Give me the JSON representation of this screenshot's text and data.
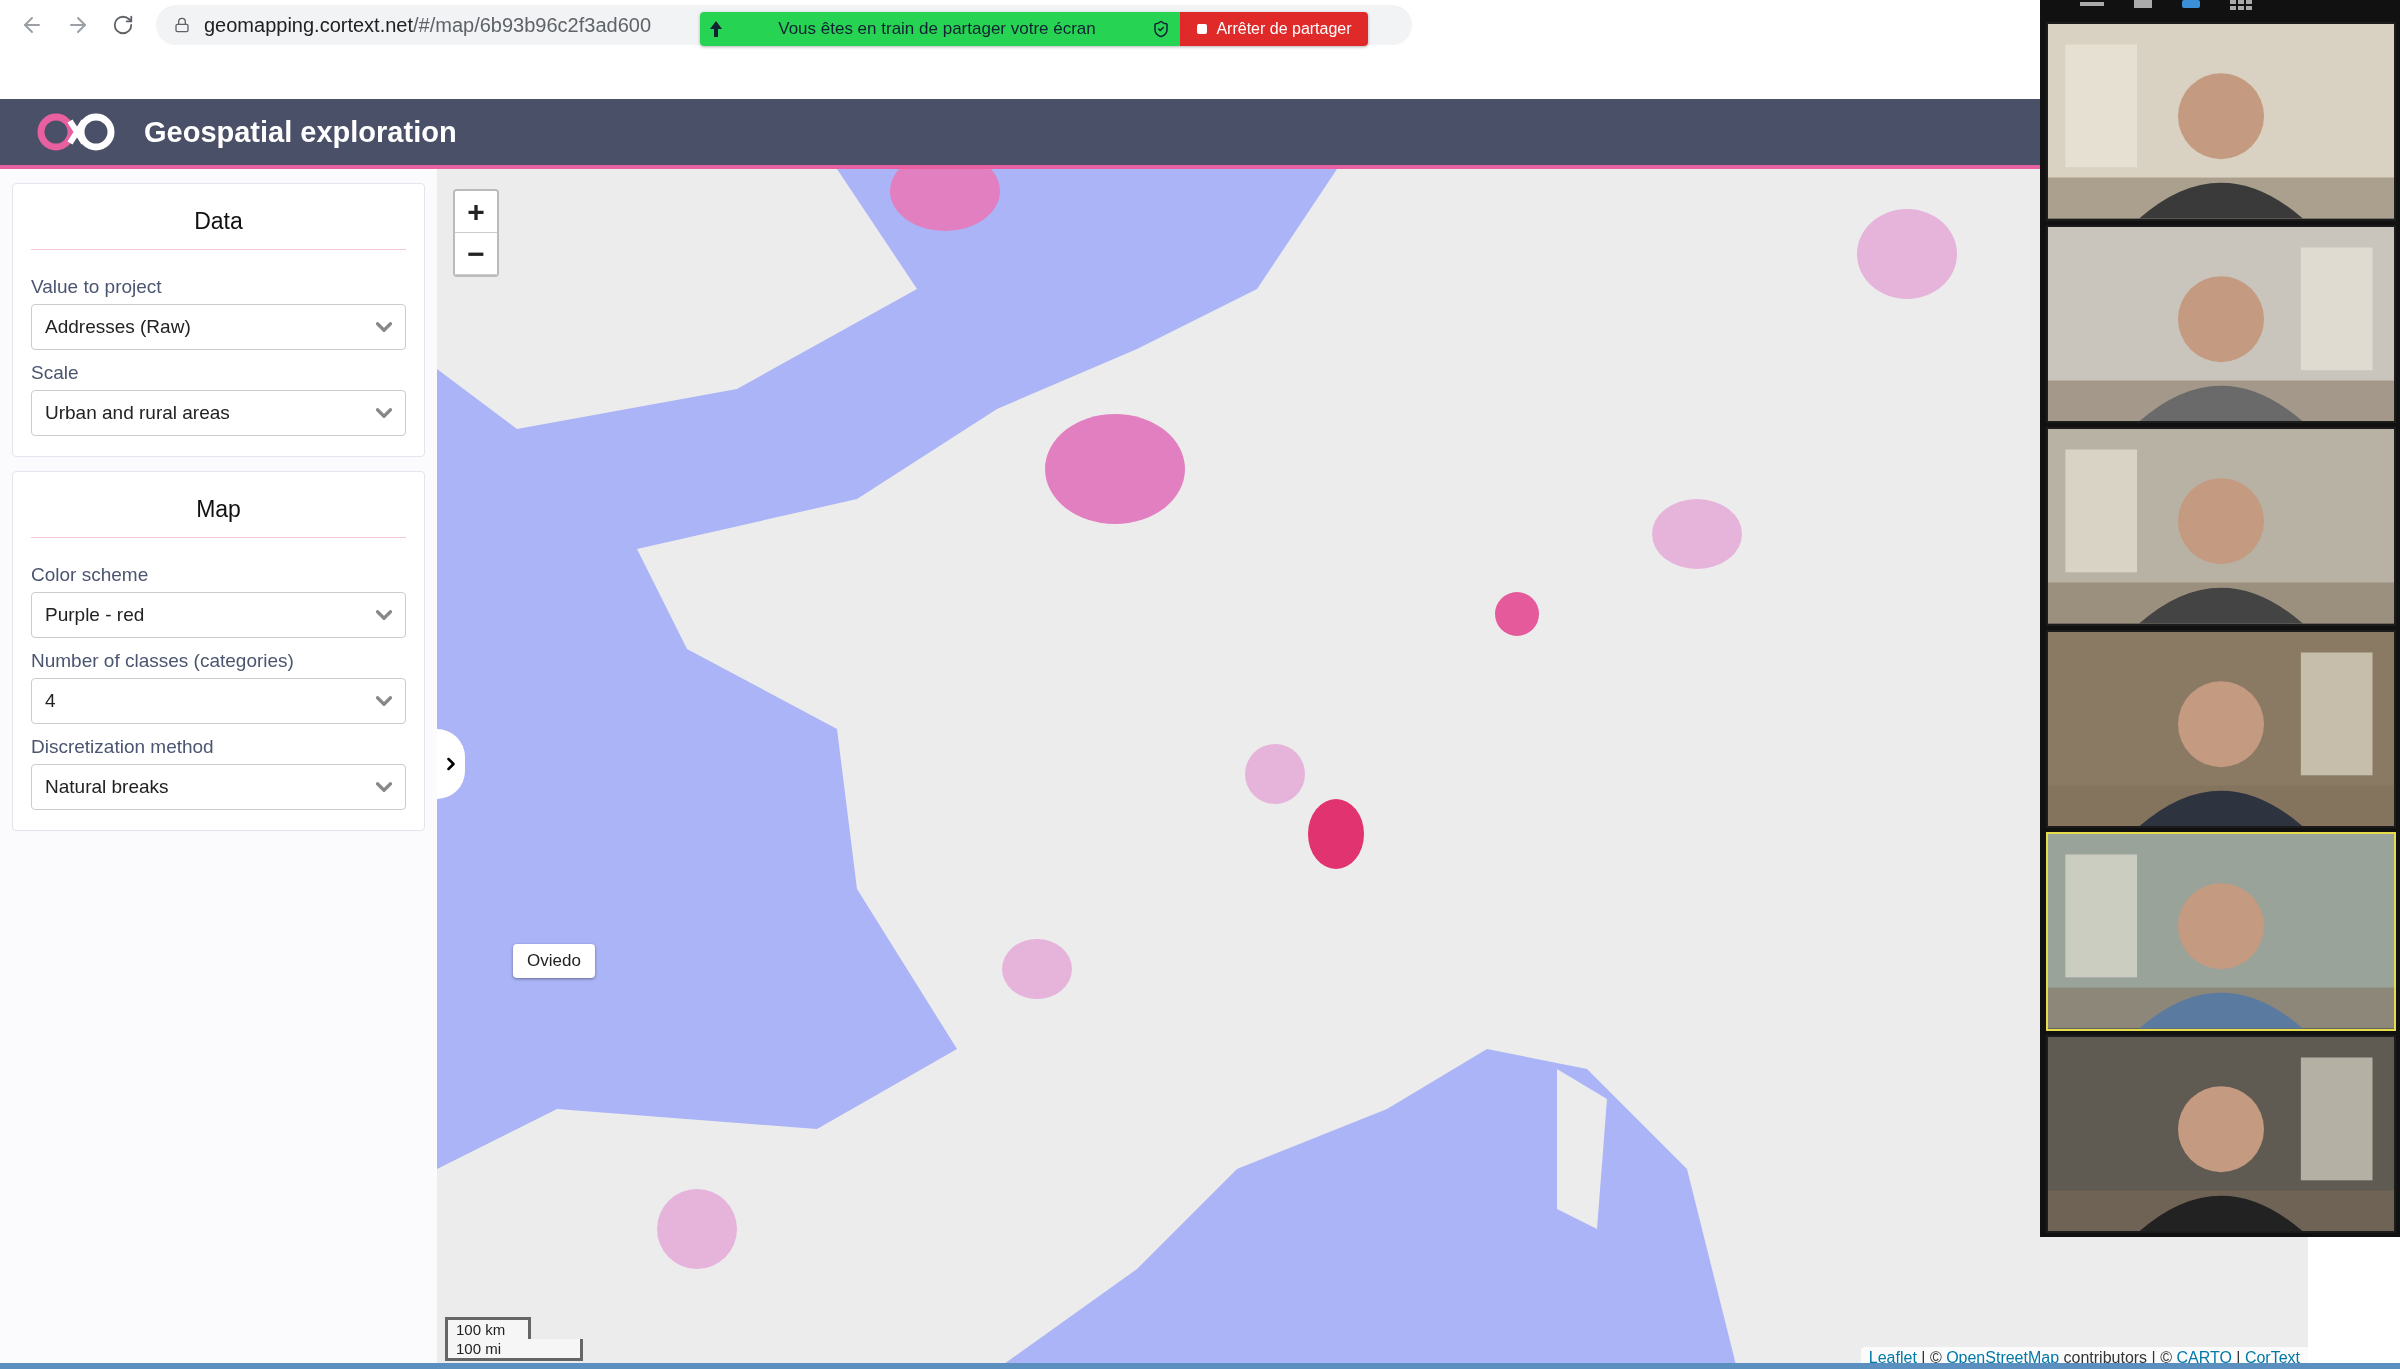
{
  "browser": {
    "address": {
      "host": "geomapping.cortext.net",
      "path": "/#/map/6b93b96c2f3ad600"
    }
  },
  "share_banner": {
    "message": "Vous êtes en train de partager votre écran",
    "stop_button": "Arrêter de partager"
  },
  "header": {
    "title": "Geospatial exploration"
  },
  "sidebar": {
    "panels": [
      {
        "title": "Data",
        "fields": [
          {
            "label": "Value to project",
            "value": "Addresses (Raw)"
          },
          {
            "label": "Scale",
            "value": "Urban and rural areas"
          }
        ]
      },
      {
        "title": "Map",
        "fields": [
          {
            "label": "Color scheme",
            "value": "Purple - red"
          },
          {
            "label": "Number of classes (categories)",
            "value": "4"
          },
          {
            "label": "Discretization method",
            "value": "Natural breaks"
          }
        ]
      }
    ]
  },
  "map": {
    "zoom_in": "+",
    "zoom_out": "−",
    "tooltip": "Oviedo",
    "scale": {
      "metric": "100 km",
      "imperial": "100 mi"
    },
    "attribution": [
      {
        "text": "Leaflet",
        "link": true
      },
      {
        "text": " | © ",
        "link": false
      },
      {
        "text": "OpenStreetMap",
        "link": true
      },
      {
        "text": " contributors | © ",
        "link": false
      },
      {
        "text": "CARTO",
        "link": true
      },
      {
        "text": " | ",
        "link": false
      },
      {
        "text": "CorText",
        "link": true
      }
    ]
  },
  "video_panel": {
    "view_buttons": [
      {
        "kind": "minimize",
        "selected": false
      },
      {
        "kind": "single",
        "selected": false
      },
      {
        "kind": "speaker",
        "selected": true
      },
      {
        "kind": "grid",
        "selected": false
      }
    ],
    "tiles": [
      {
        "active_speaker": false
      },
      {
        "active_speaker": false
      },
      {
        "active_speaker": false
      },
      {
        "active_speaker": false
      },
      {
        "active_speaker": true
      },
      {
        "active_speaker": false
      }
    ]
  }
}
